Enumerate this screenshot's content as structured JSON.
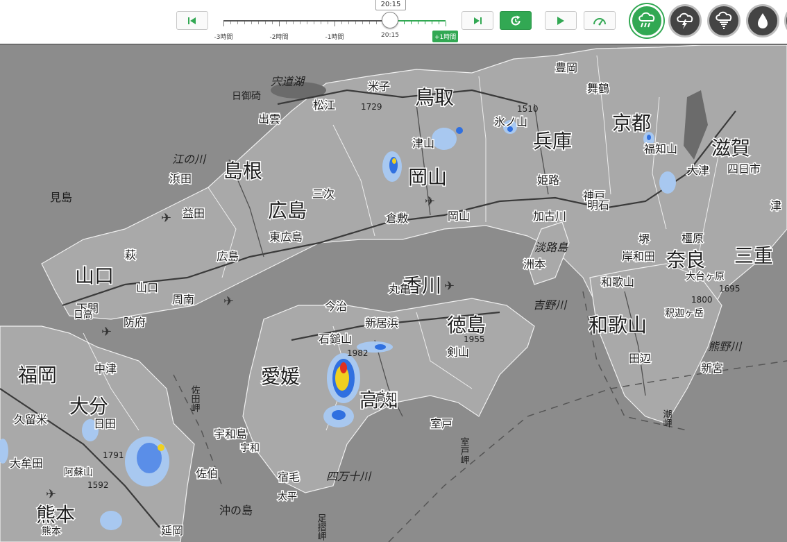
{
  "timeline": {
    "current_time": "20:15",
    "tick_labels": [
      "-3時間",
      "-2時間",
      "-1時間",
      "20:15"
    ],
    "future_label": "+1時間"
  },
  "toolbar": {
    "first_icon": "skip-to-start-icon",
    "last_icon": "skip-to-end-icon",
    "latest_icon": "latest-refresh-icon",
    "play_icon": "play-icon",
    "speed_icon": "speedometer-icon"
  },
  "layers": [
    {
      "name": "rain-radar",
      "icon": "rain-cloud-icon",
      "active": true
    },
    {
      "name": "thunder",
      "icon": "thunder-cloud-icon",
      "active": false
    },
    {
      "name": "tornado",
      "icon": "tornado-cloud-icon",
      "active": false
    },
    {
      "name": "precipitation",
      "icon": "water-drop-icon",
      "active": false
    }
  ],
  "colors": {
    "accent": "#32a853",
    "land": "#a9a9a9",
    "sea": "#8c8c8c",
    "rain_light": "#a8c8f0",
    "rain_medium": "#3070e0",
    "rain_heavy": "#f0d020",
    "rain_intense": "#e03020"
  },
  "map": {
    "prefectures": [
      "鳥取",
      "島根",
      "広島",
      "岡山",
      "兵庫",
      "京都",
      "滋賀",
      "奈良",
      "三重",
      "山口",
      "香川",
      "徳島",
      "愛媛",
      "高知",
      "和歌山",
      "大分",
      "福岡",
      "熊本"
    ],
    "cities": [
      "松江",
      "出雲",
      "浜田",
      "益田",
      "三次",
      "東広島",
      "広島",
      "萩",
      "山口",
      "周南",
      "防府",
      "下関",
      "倉敷",
      "岡山",
      "姫路",
      "神戸",
      "加古川",
      "舞鶴",
      "豊岡",
      "福知山",
      "大津",
      "四日市",
      "津",
      "堺",
      "橿原",
      "岸和田",
      "和歌山",
      "田辺",
      "新宮",
      "宇和島",
      "石鎚山",
      "新居浜",
      "高知",
      "室戸",
      "中津",
      "日田",
      "久留米",
      "大牟田",
      "阿蘇山",
      "延岡",
      "宿毛",
      "佐伯"
    ],
    "water_labels": [
      "宍道湖",
      "江の川",
      "吉野川",
      "四万十川",
      "熊野川",
      "淡路島"
    ],
    "capes": [
      "日御碕",
      "佐田岬",
      "足摺岬",
      "室戸岬",
      "潮岬"
    ],
    "islands": [
      "見島",
      "沖の島"
    ],
    "peaks": [
      "1729",
      "1510",
      "1955",
      "1982",
      "1791",
      "1592",
      "1800",
      "1695"
    ],
    "more_labels": [
      "米子",
      "津山",
      "氷ノ山",
      "明石",
      "洲本",
      "丸亀",
      "今治",
      "剣山",
      "大台ヶ原",
      "釈迦ヶ岳",
      "宇和",
      "太平",
      "日高",
      "熊本"
    ]
  }
}
